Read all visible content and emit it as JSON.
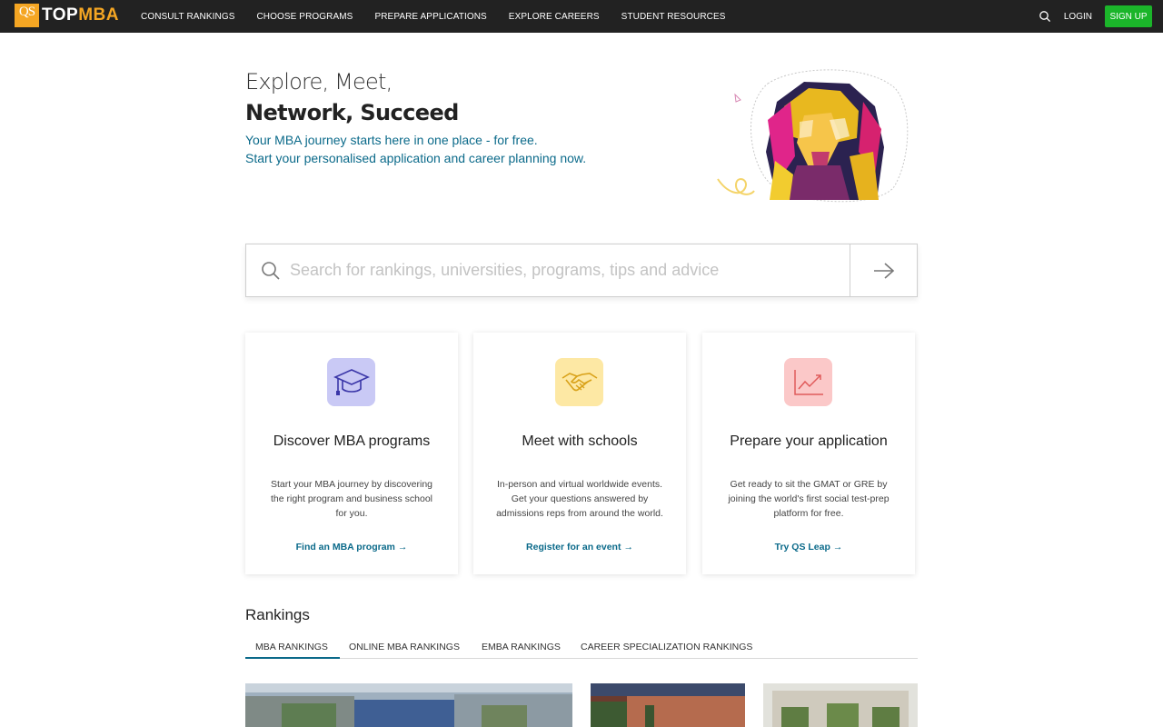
{
  "nav": {
    "logo_qs": "QS",
    "logo_top": "TOP",
    "logo_mba": "MBA",
    "links": [
      "CONSULT RANKINGS",
      "CHOOSE PROGRAMS",
      "PREPARE APPLICATIONS",
      "EXPLORE CAREERS",
      "STUDENT RESOURCES"
    ],
    "login": "LOGIN",
    "signup": "SIGN UP"
  },
  "hero": {
    "line1": "Explore, Meet,",
    "line2": "Network, Succeed",
    "sub1": "Your MBA journey starts here in one place - for free.",
    "sub2": "Start your personalised application and career planning now."
  },
  "search": {
    "placeholder": "Search for rankings, universities, programs, tips and advice"
  },
  "cards": [
    {
      "title": "Discover MBA programs",
      "description": "Start your MBA journey by discovering the right program and business school for you.",
      "link": "Find an MBA program",
      "icon": "graduation-cap-icon",
      "icon_bg": "#c9c9f5"
    },
    {
      "title": "Meet with schools",
      "description": "In-person and virtual worldwide events. Get your questions answered by admissions reps from around the world.",
      "link": "Register for an event",
      "icon": "handshake-icon",
      "icon_bg": "#fde8a4"
    },
    {
      "title": "Prepare your application",
      "description": "Get ready to sit the GMAT or GRE by joining the world's first social test-prep platform for free.",
      "link": "Try QS Leap",
      "icon": "chart-trend-icon",
      "icon_bg": "#fbc8c8"
    }
  ],
  "rankings": {
    "title": "Rankings",
    "tabs": [
      "MBA RANKINGS",
      "ONLINE MBA RANKINGS",
      "EMBA RANKINGS",
      "CAREER SPECIALIZATION RANKINGS"
    ],
    "active_tab": "MBA RANKINGS"
  },
  "colors": {
    "nav_bg": "#222222",
    "accent": "#0b6a8a",
    "logo_orange": "#f5a623",
    "signup_green": "#1bb52a"
  }
}
